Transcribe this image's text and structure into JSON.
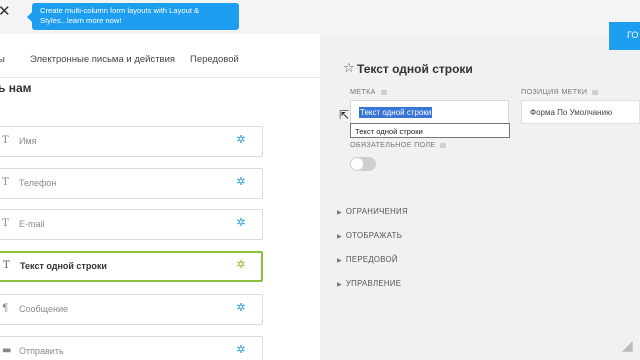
{
  "promo": {
    "text": "Create multi-column form layouts with Layout & Styles...learn more now!"
  },
  "header": {
    "close_glyph": "✕",
    "go_button_label": "ГО"
  },
  "tabs": [
    {
      "label": "ы"
    },
    {
      "label": "Электронные письма и действия"
    },
    {
      "label": "Передовой"
    }
  ],
  "form": {
    "title": "ь нам",
    "fields": [
      {
        "label": "Имя",
        "icon": "text-icon",
        "glyph": "T"
      },
      {
        "label": "Телефон",
        "icon": "text-icon",
        "glyph": "T"
      },
      {
        "label": "E-mail",
        "icon": "text-icon",
        "glyph": "T"
      },
      {
        "label": "Текст одной строки",
        "icon": "text-icon",
        "glyph": "T",
        "active": true
      },
      {
        "label": "Сообщение",
        "icon": "paragraph-icon",
        "glyph": "¶"
      },
      {
        "label": "Отправить",
        "icon": "button-icon",
        "glyph": "▬"
      }
    ]
  },
  "settings": {
    "title": "Текст одной строки",
    "label_caption": "МЕТКА",
    "label_value": "Текст одной строки",
    "autocomplete_suggestion": "Текст одной строки",
    "label_position_caption": "ПОЗИЦИЯ МЕТКИ",
    "label_position_value": "Форма По Умолчанию",
    "required_caption": "ОБЯЗАТЕЛЬНОЕ ПОЛЕ",
    "required": false,
    "sections": [
      {
        "label": "ОГРАНИЧЕНИЯ"
      },
      {
        "label": "ОТОБРАЖАТЬ"
      },
      {
        "label": "ПЕРЕДОВОЙ"
      },
      {
        "label": "УПРАВЛЕНИЕ"
      }
    ]
  },
  "colors": {
    "accent": "#1e9ef0",
    "active_field_border": "#8bbf34",
    "gear": "#2a9de0",
    "selection": "#3875d7"
  }
}
